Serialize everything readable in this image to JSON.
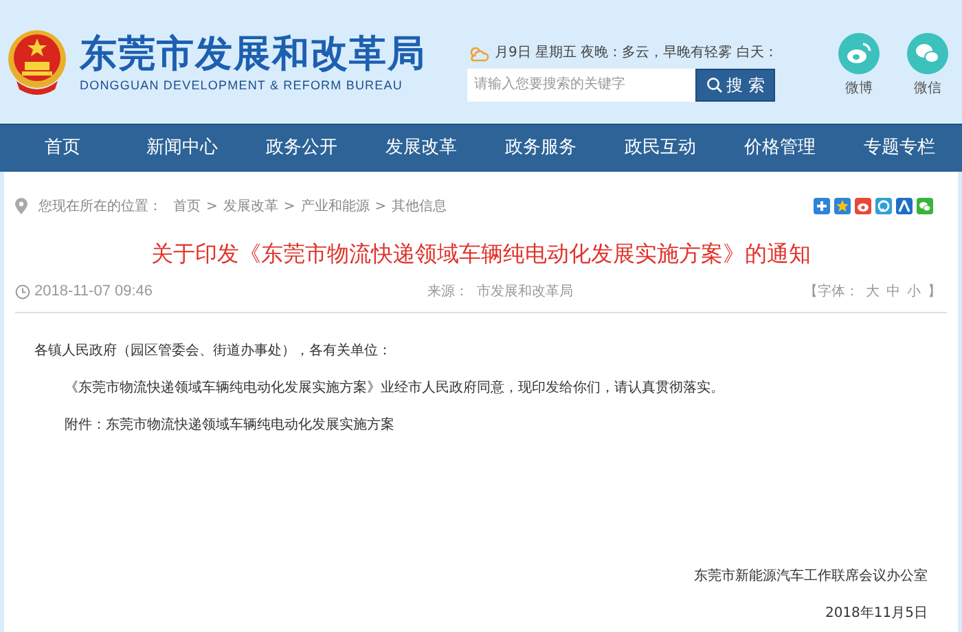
{
  "header": {
    "title": "东莞市发展和改革局",
    "subtitle": "DONGGUAN DEVELOPMENT & REFORM BUREAU",
    "weather": "月9日 星期五 夜晚：多云，早晚有轻雾 白天：",
    "search": {
      "placeholder": "请输入您要搜索的关键字",
      "button": "搜 索"
    },
    "social": [
      {
        "kind": "weibo",
        "label": "微博"
      },
      {
        "kind": "wechat",
        "label": "微信"
      }
    ]
  },
  "nav": [
    {
      "label": "首页",
      "selected": false
    },
    {
      "label": "新闻中心",
      "selected": false
    },
    {
      "label": "政务公开",
      "selected": false
    },
    {
      "label": "发展改革",
      "selected": false
    },
    {
      "label": "政务服务",
      "selected": false
    },
    {
      "label": "政民互动",
      "selected": false
    },
    {
      "label": "价格管理",
      "selected": false
    },
    {
      "label": "专题专栏",
      "selected": false
    }
  ],
  "breadcrumb": {
    "label": "您现在所在的位置：",
    "separator": ">",
    "items": [
      "首页",
      "发展改革",
      "产业和能源",
      "其他信息"
    ]
  },
  "article": {
    "title": "关于印发《东莞市物流快递领域车辆纯电动化发展实施方案》的通知",
    "date": "2018-11-07 09:46",
    "source_label": "来源：",
    "source": "市发展和改革局",
    "font_size": {
      "open": "【字体：",
      "options": [
        "大",
        "中",
        "小"
      ],
      "close": "】"
    },
    "paragraphs": [
      {
        "kind": "salutation",
        "text": "各镇人民政府（园区管委会、街道办事处），各有关单位："
      },
      {
        "kind": "indent",
        "text": "《东莞市物流快递领域车辆纯电动化发展实施方案》业经市人民政府同意，现印发给你们，请认真贯彻落实。"
      },
      {
        "kind": "indent",
        "text": "附件：东莞市物流快递领域车辆纯电动化发展实施方案"
      }
    ],
    "signature": "东莞市新能源汽车工作联席会议办公室",
    "signed_date": "2018年11月5日"
  }
}
